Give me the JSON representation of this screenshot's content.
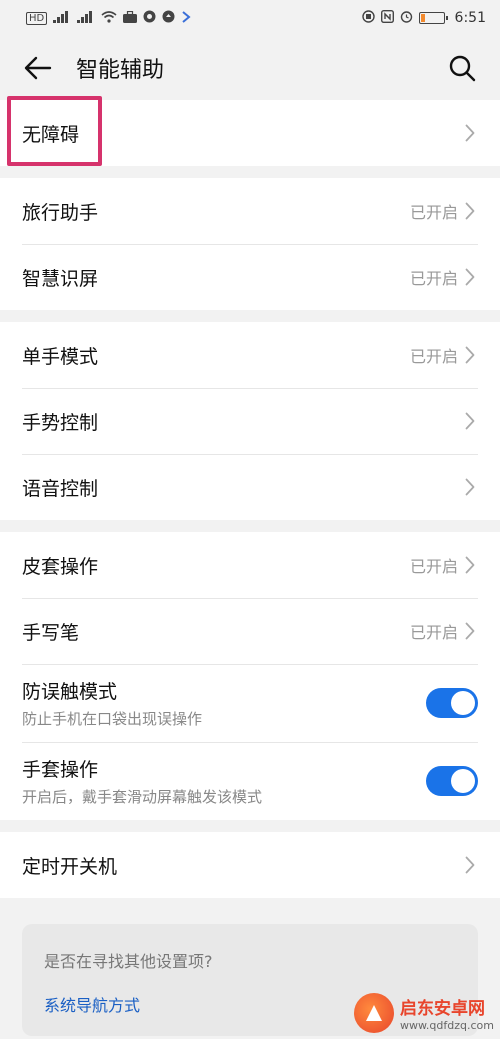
{
  "statusbar": {
    "left_glyphs": [
      "HD",
      "4G",
      "4G",
      "wifi",
      "briefcase",
      "camera",
      "app",
      "arrow"
    ],
    "hd_label": "HD",
    "sig1": "⁴ᴳ",
    "sig2": "⁴ᴳ",
    "time": "6:51",
    "battery_level": 0.2
  },
  "header": {
    "title": "智能辅助"
  },
  "groups": [
    [
      {
        "label": "无障碍",
        "status": ""
      }
    ],
    [
      {
        "label": "旅行助手",
        "status": "已开启"
      },
      {
        "label": "智慧识屏",
        "status": "已开启"
      }
    ],
    [
      {
        "label": "单手模式",
        "status": "已开启"
      },
      {
        "label": "手势控制",
        "status": ""
      },
      {
        "label": "语音控制",
        "status": ""
      }
    ],
    [
      {
        "label": "皮套操作",
        "status": "已开启"
      },
      {
        "label": "手写笔",
        "status": "已开启"
      },
      {
        "label": "防误触模式",
        "sub": "防止手机在口袋出现误操作",
        "toggle": true
      },
      {
        "label": "手套操作",
        "sub": "开启后，戴手套滑动屏幕触发该模式",
        "toggle": true
      }
    ],
    [
      {
        "label": "定时开关机",
        "status": ""
      }
    ]
  ],
  "suggest": {
    "question": "是否在寻找其他设置项?",
    "link": "系统导航方式"
  },
  "watermark": {
    "title": "启东安卓网",
    "url": "www.qdfdzq.com"
  },
  "colors": {
    "accent": "#1a73e8",
    "highlight": "#d6336c",
    "link": "#1a5fc4"
  }
}
